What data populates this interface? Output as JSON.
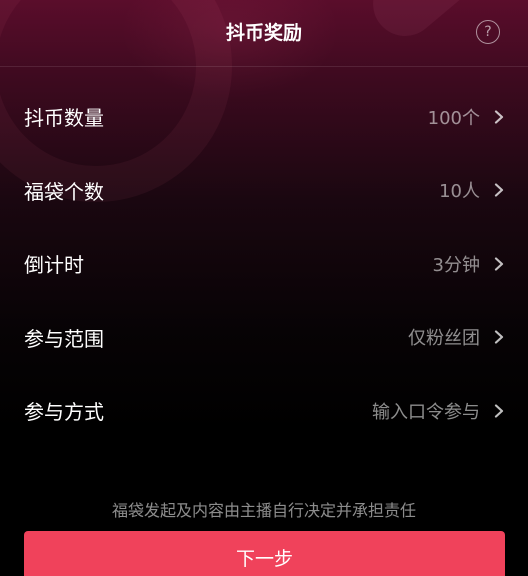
{
  "header": {
    "title": "抖币奖励",
    "help_icon": "?"
  },
  "settings": [
    {
      "label": "抖币数量",
      "value": "100个"
    },
    {
      "label": "福袋个数",
      "value": "10人"
    },
    {
      "label": "倒计时",
      "value": "3分钟"
    },
    {
      "label": "参与范围",
      "value": "仅粉丝团"
    },
    {
      "label": "参与方式",
      "value": "输入口令参与"
    }
  ],
  "footer": {
    "disclaimer": "福袋发起及内容由主播自行决定并承担责任",
    "next_label": "下一步"
  },
  "colors": {
    "accent": "#f0425b",
    "header_bg": "#5a0d2b",
    "background": "#000000"
  },
  "icons": {
    "help": "question-circle-icon",
    "row_arrow": "chevron-right-icon"
  }
}
